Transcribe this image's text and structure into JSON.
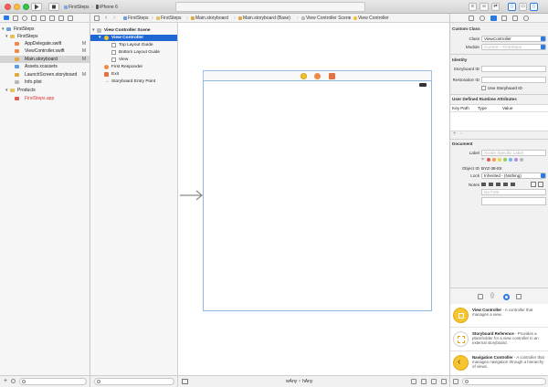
{
  "toolbar": {
    "project_name": "FirstSteps",
    "device_name": "iPhone 6",
    "play_icon": "play-icon",
    "stop_icon": "stop-icon"
  },
  "navigator": {
    "items": [
      {
        "label": "FirstSteps",
        "badge": "",
        "level": 0,
        "icon": "project-icon"
      },
      {
        "label": "FirstSteps",
        "badge": "",
        "level": 1,
        "icon": "folder-icon"
      },
      {
        "label": "AppDelegate.swift",
        "badge": "M",
        "level": 2,
        "icon": "swift-file-icon"
      },
      {
        "label": "ViewController.swift",
        "badge": "M",
        "level": 2,
        "icon": "swift-file-icon"
      },
      {
        "label": "Main.storyboard",
        "badge": "M",
        "level": 2,
        "icon": "storyboard-icon"
      },
      {
        "label": "Assets.xcassets",
        "badge": "",
        "level": 2,
        "icon": "assets-icon"
      },
      {
        "label": "LaunchScreen.storyboard",
        "badge": "M",
        "level": 2,
        "icon": "storyboard-icon"
      },
      {
        "label": "Info.plist",
        "badge": "",
        "level": 2,
        "icon": "plist-icon"
      },
      {
        "label": "Products",
        "badge": "",
        "level": 1,
        "icon": "folder-icon"
      },
      {
        "label": "FirstSteps.app",
        "badge": "",
        "level": 2,
        "icon": "app-icon"
      }
    ]
  },
  "jumpbar": {
    "crumbs": [
      "FirstSteps",
      "FirstSteps",
      "Main.storyboard",
      "Main.storyboard (Base)",
      "View Controller Scene",
      "View Controller"
    ]
  },
  "outline": {
    "items": [
      {
        "label": "View Controller Scene",
        "level": 0,
        "bold": true
      },
      {
        "label": "View Controller",
        "level": 1,
        "bold": true
      },
      {
        "label": "Top Layout Guide",
        "level": 2
      },
      {
        "label": "Bottom Layout Guide",
        "level": 2
      },
      {
        "label": "View",
        "level": 2
      },
      {
        "label": "First Responder",
        "level": 1
      },
      {
        "label": "Exit",
        "level": 1
      },
      {
        "label": "Storyboard Entry Point",
        "level": 1
      }
    ]
  },
  "canvas": {
    "size_class_width": "wAny",
    "size_class_height": "hAny"
  },
  "inspector": {
    "custom_class": {
      "title": "Custom Class",
      "class_label": "Class",
      "class_value": "ViewController",
      "module_label": "Module",
      "module_placeholder": "Current – FirstSteps"
    },
    "identity": {
      "title": "Identity",
      "storyboard_id_label": "Storyboard ID",
      "restoration_id_label": "Restoration ID",
      "use_storyboard_id_label": "Use Storyboard ID"
    },
    "runtime": {
      "title": "User Defined Runtime Attributes",
      "col_key_path": "Key Path",
      "col_type": "Type",
      "col_value": "Value"
    },
    "document": {
      "title": "Document",
      "label_label": "Label",
      "label_placeholder": "Xcode Specific Label",
      "object_id_label": "Object ID",
      "object_id_value": "BYZ-38-t0r",
      "lock_label": "Lock",
      "lock_value": "Inherited - (Nothing)",
      "notes_label": "Notes",
      "font_placeholder": "No Font",
      "label_colors": [
        "#e05a5a",
        "#f0a04a",
        "#f2d44e",
        "#8fd16a",
        "#6cb5f0",
        "#b58be8",
        "#b8b8b8"
      ]
    }
  },
  "library": {
    "items": [
      {
        "title": "View Controller",
        "desc": " - A controller that manages a view."
      },
      {
        "title": "Storyboard Reference",
        "desc": " - Provides a placeholder for a view controller in an external storyboard."
      },
      {
        "title": "Navigation Controller",
        "desc": " - A controller that manages navigation through a hierarchy of views."
      }
    ]
  }
}
